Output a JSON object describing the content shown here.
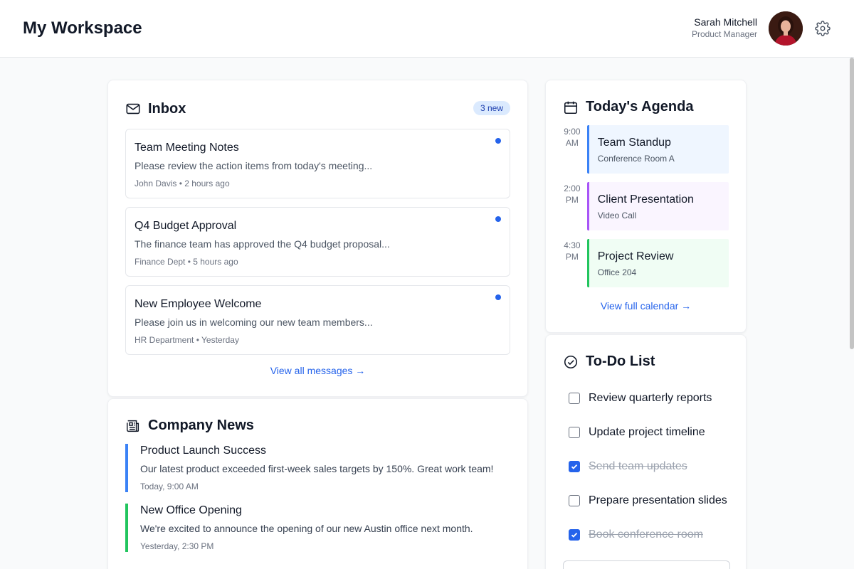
{
  "header": {
    "title": "My Workspace",
    "user": {
      "name": "Sarah Mitchell",
      "role": "Product Manager"
    }
  },
  "inbox": {
    "title": "Inbox",
    "badge": "3 new",
    "messages": [
      {
        "subject": "Team Meeting Notes",
        "preview": "Please review the action items from today's meeting...",
        "meta": "John Davis • 2 hours ago"
      },
      {
        "subject": "Q4 Budget Approval",
        "preview": "The finance team has approved the Q4 budget proposal...",
        "meta": "Finance Dept • 5 hours ago"
      },
      {
        "subject": "New Employee Welcome",
        "preview": "Please join us in welcoming our new team members...",
        "meta": "HR Department • Yesterday"
      }
    ],
    "view_all": "View all messages →"
  },
  "news": {
    "title": "Company News",
    "items": [
      {
        "title": "Product Launch Success",
        "body": "Our latest product exceeded first-week sales targets by 150%. Great work team!",
        "date": "Today, 9:00 AM",
        "accent": "#3b82f6"
      },
      {
        "title": "New Office Opening",
        "body": "We're excited to announce the opening of our new Austin office next month.",
        "date": "Yesterday, 2:30 PM",
        "accent": "#22c55e"
      }
    ]
  },
  "agenda": {
    "title": "Today's Agenda",
    "events": [
      {
        "time_hm": "9:00",
        "time_ampm": "AM",
        "title": "Team Standup",
        "location": "Conference Room A",
        "accent": "#3b82f6",
        "bg": "#eff6ff"
      },
      {
        "time_hm": "2:00",
        "time_ampm": "PM",
        "title": "Client Presentation",
        "location": "Video Call",
        "accent": "#a855f7",
        "bg": "#faf5ff"
      },
      {
        "time_hm": "4:30",
        "time_ampm": "PM",
        "title": "Project Review",
        "location": "Office 204",
        "accent": "#22c55e",
        "bg": "#f0fdf4"
      }
    ],
    "view_full": "View full calendar →"
  },
  "todo": {
    "title": "To-Do List",
    "items": [
      {
        "label": "Review quarterly reports",
        "done": false
      },
      {
        "label": "Update project timeline",
        "done": false
      },
      {
        "label": "Send team updates",
        "done": true
      },
      {
        "label": "Prepare presentation slides",
        "done": false
      },
      {
        "label": "Book conference room",
        "done": true
      }
    ]
  },
  "colors": {
    "accent": "#2563eb",
    "badge_bg": "#dbeafe"
  }
}
